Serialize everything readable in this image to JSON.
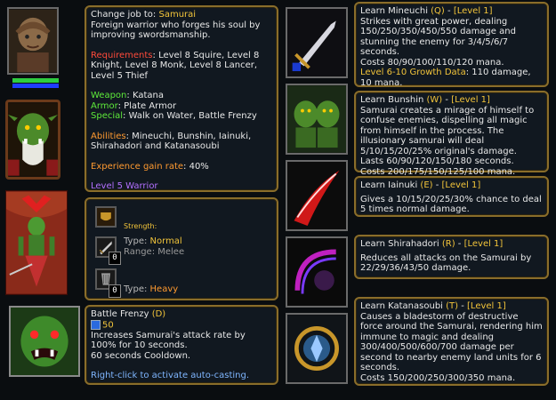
{
  "job_panel": {
    "title_prefix": "Change job to: ",
    "title_job": "Samurai",
    "description": "Foreign warrior who forges his soul by improving swordsmanship.",
    "requirements_label": "Requirements",
    "requirements_text": ": Level 8 Squire, Level 8 Knight, Level 8 Monk, Level 8 Lancer, Level 5 Thief",
    "weapon_label": "Weapon",
    "weapon_value": ": Katana",
    "armor_label": "Armor",
    "armor_value": ": Plate Armor",
    "special_label": "Special",
    "special_value": ": Walk on Water, Battle Frenzy",
    "abilities_label": "Abilities",
    "abilities_value": ": Mineuchi, Bunshin, Iainuki, Shirahadori and Katanasoubi",
    "exp_label": "Experience gain rate",
    "exp_value": ": 40%",
    "class_level": "Level 5 Warrior"
  },
  "stats_panel": {
    "strength_label": "Strength:",
    "attack_type_label": "Type: ",
    "attack_type_value": "Normal",
    "range_text": "Range: Melee",
    "armor_type_label": "Type: ",
    "armor_type_value": "Heavy",
    "attack_badge": "0",
    "armor_badge": "0"
  },
  "battle_frenzy": {
    "name": "Battle Frenzy ",
    "hotkey": "(D)",
    "mana_cost": "50",
    "line1": "Increases Samurai's attack rate by 100% for 10 seconds.",
    "line2": "60 seconds Cooldown.",
    "hint": "Right-click to activate auto-casting."
  },
  "skills": [
    {
      "learn": "Learn Mineuchi ",
      "hotkey": "(Q)",
      "sep": " - ",
      "level": "[Level 1]",
      "desc": "Strikes with great power, dealing 150/250/350/450/550 damage and stunning the enemy for 3/4/5/6/7 seconds.",
      "cost": "Costs 80/90/100/110/120 mana.",
      "extra_label": "Level 6-10 Growth Data",
      "extra_value": ": 110 damage, 10 mana."
    },
    {
      "learn": "Learn Bunshin ",
      "hotkey": "(W)",
      "sep": " - ",
      "level": "[Level 1]",
      "desc": "Samurai creates a mirage of himself to confuse enemies, dispelling all magic from himself in the process. The illusionary samurai will deal 5/10/15/20/25% original's damage. Lasts 60/90/120/150/180 seconds.",
      "cost": "Costs 200/175/150/125/100 mana."
    },
    {
      "learn": "Learn Iainuki ",
      "hotkey": "(E)",
      "sep": " - ",
      "level": "[Level 1]",
      "desc": "Gives a 10/15/20/25/30% chance to deal 5 times normal damage."
    },
    {
      "learn": "Learn Shirahadori ",
      "hotkey": "(R)",
      "sep": " - ",
      "level": "[Level 1]",
      "desc": "Reduces all attacks on the Samurai by 22/29/36/43/50 damage."
    },
    {
      "learn": "Learn Katanasoubi ",
      "hotkey": "(T)",
      "sep": " - ",
      "level": "[Level 1]",
      "desc": "Causes a bladestorm of destructive force around the Samurai, rendering him immune to magic and dealing 300/400/500/600/700 damage per second to nearby enemy land units for 6 seconds.",
      "cost": "Costs 150/200/250/300/350 mana."
    }
  ],
  "colors": {
    "panel_border": "#8a6d2a",
    "hotkey": "#f2c43a",
    "requirements": "#ff4a3a",
    "equipment": "#5eea3a",
    "abilities": "#ff9a30",
    "class_level": "#b470ff",
    "health_bar": "#2ecc40",
    "mana_bar": "#1f3cff"
  },
  "icons": {
    "hero_portrait": "samurai-hero-portrait",
    "orc_portrait": "orc-warrior-portrait",
    "model_view": "orc-model-view",
    "battle_frenzy": "battle-frenzy-icon",
    "mineuchi": "sword-icon",
    "bunshin": "mirror-image-icon",
    "iainuki": "critical-strike-icon",
    "shirahadori": "shield-aura-icon",
    "katanasoubi": "bladestorm-icon"
  }
}
